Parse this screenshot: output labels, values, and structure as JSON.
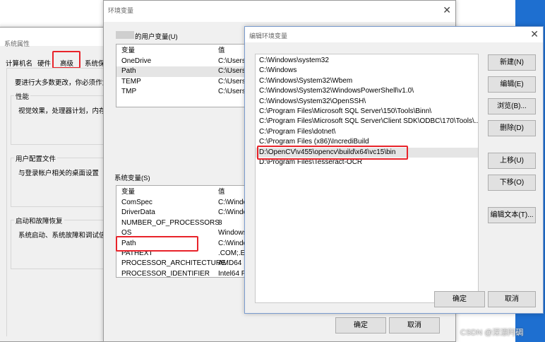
{
  "system_properties": {
    "title": "系统属性",
    "tabs": [
      "计算机名",
      "硬件",
      "高级",
      "系统保"
    ],
    "admin_note": "要进行大多数更改，你必须作为",
    "perf": {
      "title": "性能",
      "desc": "视觉效果，处理器计划，内存"
    },
    "profile": {
      "title": "用户配置文件",
      "desc": "与登录帐户相关的桌面设置"
    },
    "startup": {
      "title": "启动和故障恢复",
      "desc": "系统启动、系统故障和调试信"
    }
  },
  "env_vars": {
    "title": "环境变量",
    "user_section": "的用户变量(U)",
    "col_var": "变量",
    "col_val": "值",
    "user_rows": [
      {
        "name": "OneDrive",
        "value": "C:\\Users\\"
      },
      {
        "name": "Path",
        "value": "C:\\Users\\"
      },
      {
        "name": "TEMP",
        "value": "C:\\Users\\"
      },
      {
        "name": "TMP",
        "value": "C:\\Users\\"
      }
    ],
    "sys_section": "系统变量(S)",
    "sys_rows": [
      {
        "name": "ComSpec",
        "value": "C:\\Windo"
      },
      {
        "name": "DriverData",
        "value": "C:\\Windo"
      },
      {
        "name": "NUMBER_OF_PROCESSORS",
        "value": "8"
      },
      {
        "name": "OS",
        "value": "Windows"
      },
      {
        "name": "Path",
        "value": "C:\\Windo"
      },
      {
        "name": "PATHEXT",
        "value": ".COM;.EX"
      },
      {
        "name": "PROCESSOR_ARCHITECTURE",
        "value": "AMD64"
      },
      {
        "name": "PROCESSOR_IDENTIFIER",
        "value": "Intel64 F"
      }
    ],
    "ok": "确定",
    "cancel": "取消"
  },
  "edit_dialog": {
    "title": "编辑环境变量",
    "paths": [
      "C:\\Windows\\system32",
      "C:\\Windows",
      "C:\\Windows\\System32\\Wbem",
      "C:\\Windows\\System32\\WindowsPowerShell\\v1.0\\",
      "C:\\Windows\\System32\\OpenSSH\\",
      "C:\\Program Files\\Microsoft SQL Server\\150\\Tools\\Binn\\",
      "C:\\Program Files\\Microsoft SQL Server\\Client SDK\\ODBC\\170\\Tools\\...",
      "C:\\Program Files\\dotnet\\",
      "C:\\Program Files (x86)\\IncrediBuild",
      "D:\\OpenCV\\v455\\opencv\\build\\x64\\vc15\\bin",
      "D:\\Program Files\\Tesseract-OCR"
    ],
    "buttons": {
      "new": "新建(N)",
      "edit": "编辑(E)",
      "browse": "浏览(B)...",
      "delete": "删除(D)",
      "up": "上移(U)",
      "down": "下移(O)",
      "edit_text": "编辑文本(T)..."
    },
    "ok": "确定",
    "cancel": "取消"
  },
  "watermark": "CSDN @深漂阿碉",
  "colors": {
    "highlight": "#e8232a",
    "selected_row": "#e5e5e5",
    "accent_blue": "#0078d7"
  }
}
